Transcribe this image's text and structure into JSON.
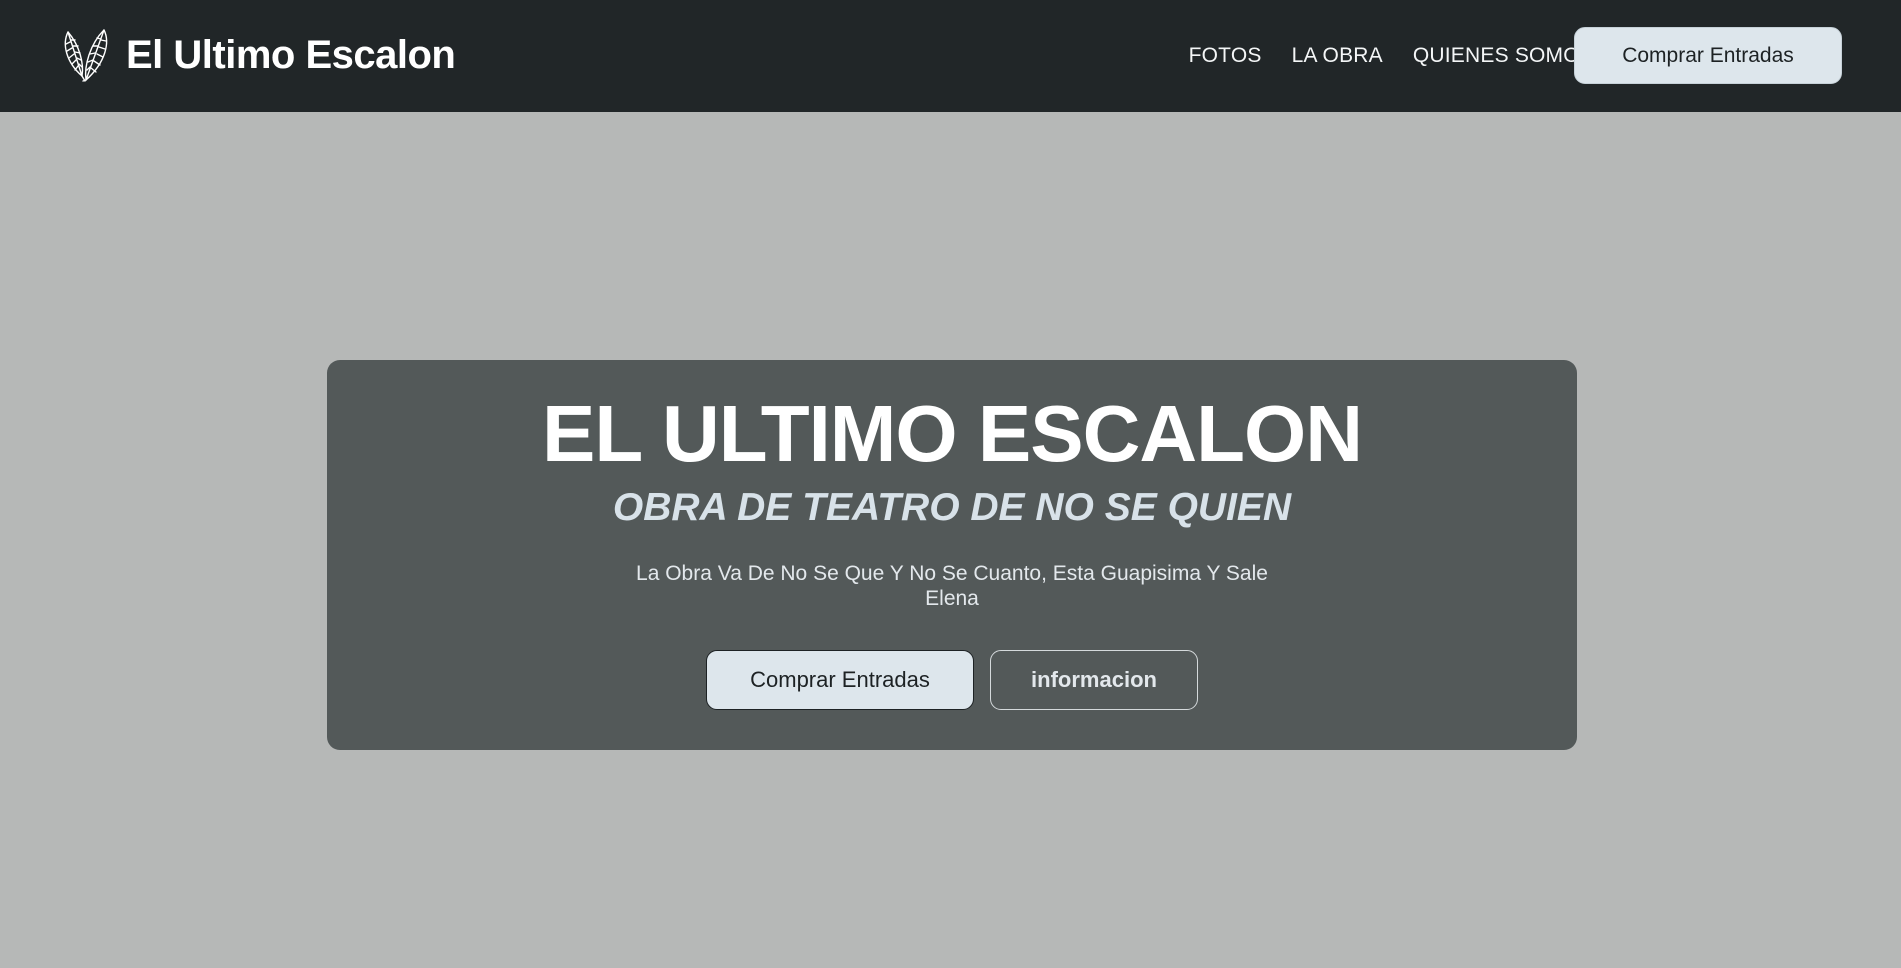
{
  "header": {
    "brand_title": "El Ultimo Escalon",
    "logo_icon": "feathers-icon",
    "nav_items": [
      {
        "label": "FOTOS"
      },
      {
        "label": "LA OBRA"
      },
      {
        "label": "QUIENES SOMOS"
      }
    ],
    "cta_label": "Comprar Entradas"
  },
  "hero": {
    "title": "EL ULTIMO ESCALON",
    "subtitle": "OBRA DE TEATRO DE NO SE QUIEN",
    "description": "La Obra Va De No Se Que Y No Se Cuanto, Esta Guapisima Y Sale Elena",
    "primary_button_label": "Comprar Entradas",
    "secondary_button_label": "informacion"
  },
  "colors": {
    "navbar_bg": "#212628",
    "page_bg": "#b6b8b7",
    "card_bg": "#535959",
    "button_light": "#dde6ec",
    "subtitle": "#d8e2e9"
  }
}
